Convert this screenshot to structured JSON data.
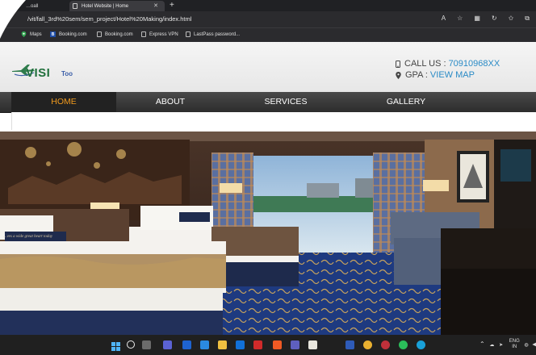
{
  "browser": {
    "tabs": [
      {
        "label": "…oall"
      },
      {
        "label": "Hotel Website | Home"
      }
    ],
    "new_tab": "+",
    "url": "/vit/fall_3rd%20sem/sem_project/Hotel%20Making/index.html",
    "bookmarks": [
      {
        "label": "Maps",
        "icon": "maps-icon"
      },
      {
        "label": "Booking.com",
        "icon": "booking-icon"
      },
      {
        "label": "Booking.com",
        "icon": "page-icon"
      },
      {
        "label": "Express VPN",
        "icon": "page-icon"
      },
      {
        "label": "LastPass password...",
        "icon": "page-icon"
      }
    ]
  },
  "site": {
    "logo_text": "VISI",
    "logo_sub": "Too",
    "call_label": "CALL US :",
    "call_number": "70910968XX",
    "gpa_label": "GPA :",
    "gpa_link": "VIEW MAP",
    "nav": [
      {
        "label": "HOME",
        "active": true
      },
      {
        "label": "ABOUT",
        "active": false
      },
      {
        "label": "SERVICES",
        "active": false
      },
      {
        "label": "GALLERY",
        "active": false
      }
    ],
    "hero_pillow_text": "…ves a wide great heart today"
  },
  "taskbar": {
    "lang": "ENG",
    "region": "IN"
  },
  "colors": {
    "accent_nav_active": "#f09a1e",
    "link": "#2a8bc6",
    "logo_green": "#1f6f3b"
  }
}
